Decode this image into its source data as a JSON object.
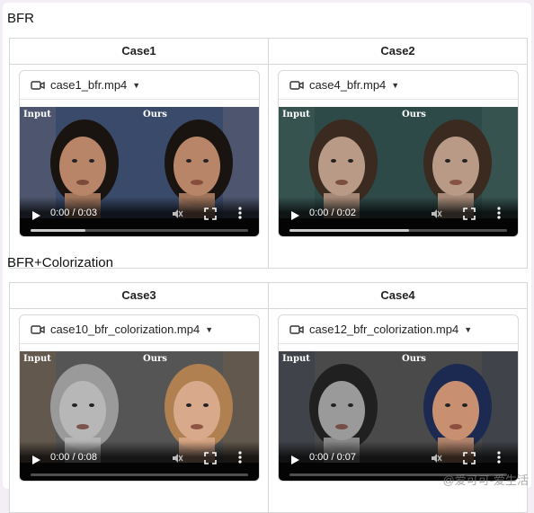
{
  "sections": [
    {
      "title": "BFR",
      "cases": [
        {
          "header": "Case1",
          "file": "case1_bfr.mp4",
          "time": "0:00 / 0:03",
          "progress": 0.25,
          "palette": {
            "bg1": "#3a4a6a",
            "bg2": "#5a5f72",
            "skin": "#b98568",
            "hair": "#1a1410"
          }
        },
        {
          "header": "Case2",
          "file": "case4_bfr.mp4",
          "time": "0:00 / 0:02",
          "progress": 0.55,
          "palette": {
            "bg1": "#2e4a48",
            "bg2": "#3c5a56",
            "skin": "#b99a86",
            "hair": "#3a2a20"
          }
        }
      ]
    },
    {
      "title": "BFR+Colorization",
      "cases": [
        {
          "header": "Case3",
          "file": "case10_bfr_colorization.mp4",
          "time": "0:00 / 0:08",
          "progress": 0.0,
          "palette": {
            "bg1": "#555555",
            "bg2": "#6b5a48",
            "skin": "#b7b7b7",
            "hair": "#9a9a9a",
            "skin2": "#d9a98c",
            "hair2": "#b08050"
          }
        },
        {
          "header": "Case4",
          "file": "case12_bfr_colorization.mp4",
          "time": "0:00 / 0:07",
          "progress": 0.0,
          "palette": {
            "bg1": "#4a4a4a",
            "bg2": "#3a3f4a",
            "skin": "#9a9a9a",
            "hair": "#202020",
            "skin2": "#c89070",
            "hair2": "#1c2a52"
          }
        }
      ]
    }
  ],
  "labels": {
    "input": "Input",
    "ours": "Ours"
  },
  "watermark": "@爱可可-爱生活",
  "icons": {
    "camera": "video-camera-icon",
    "caret": "chevron-down-icon"
  }
}
